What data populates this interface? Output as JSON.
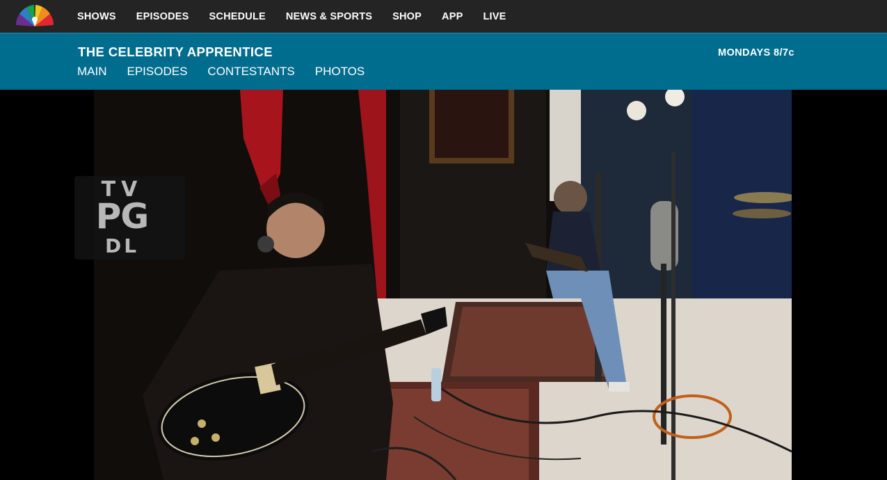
{
  "topnav": {
    "logo_icon": "nbc-peacock-icon",
    "links": [
      "SHOWS",
      "EPISODES",
      "SCHEDULE",
      "NEWS & SPORTS",
      "SHOP",
      "APP",
      "LIVE"
    ]
  },
  "show": {
    "title": "THE CELEBRITY APPRENTICE",
    "airtime": "MONDAYS 8/7c",
    "tabs": [
      "MAIN",
      "EPISODES",
      "CONTESTANTS",
      "PHOTOS"
    ]
  },
  "rating": {
    "line1": "TV",
    "line2": "PG",
    "line3": "DL"
  },
  "colors": {
    "topnav_bg": "#242424",
    "showbar_bg": "#006d8f"
  }
}
